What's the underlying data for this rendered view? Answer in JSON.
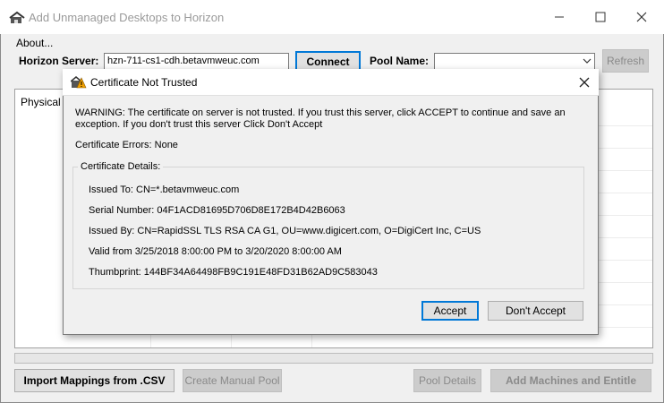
{
  "window": {
    "title": "Add Unmanaged Desktops to Horizon"
  },
  "menu": {
    "about": "About..."
  },
  "toolbar": {
    "server_label": "Horizon Server:",
    "server_value": "hzn-711-cs1-cdh.betavmweuc.com",
    "connect_label": "Connect",
    "pool_label": "Pool Name:",
    "pool_value": "",
    "refresh_label": "Refresh"
  },
  "grid": {
    "column1": "Physical M"
  },
  "bottom": {
    "import_label": "Import Mappings from .CSV",
    "manual_label": "Create Manual Pool",
    "pool_details_label": "Pool Details",
    "add_machines_label": "Add Machines and Entitle"
  },
  "dialog": {
    "title": "Certificate Not Trusted",
    "warning_line1": "WARNING: The certificate on server is not trusted. If you trust this server, click ACCEPT to continue and save an",
    "warning_line2": "exception.  If you don't trust this server Click Don't Accept",
    "cert_errors": "Certificate Errors: None",
    "details_legend": "Certificate Details:",
    "issued_to": "Issued To: CN=*.betavmweuc.com",
    "serial": "Serial Number: 04F1ACD81695D706D8E172B4D42B6063",
    "issued_by": "Issued By: CN=RapidSSL TLS RSA CA G1, OU=www.digicert.com, O=DigiCert Inc, C=US",
    "valid": "Valid from 3/25/2018 8:00:00 PM to 3/20/2020 8:00:00 AM",
    "thumbprint": "Thumbprint: 144BF34A64498FB9C191E48FD31B62AD9C583043",
    "accept_label": "Accept",
    "dont_accept_label": "Don't Accept"
  },
  "colors": {
    "accent": "#0078d7",
    "warning_icon": "#f0a000"
  },
  "icons": [
    "app-icon",
    "minimize-icon",
    "maximize-icon",
    "close-icon",
    "chevron-down-icon",
    "warning-icon",
    "dialog-close-icon"
  ]
}
